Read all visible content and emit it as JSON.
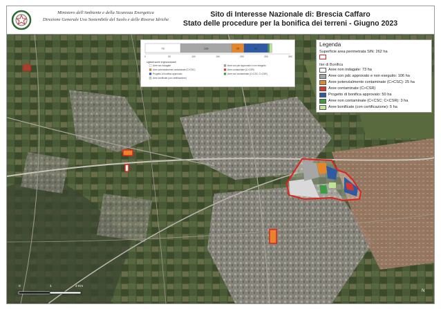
{
  "header": {
    "ministry_line1": "Ministero dell'Ambiente e della Sicurezza Energetica",
    "ministry_line2": "Direzione Generale Uso Sostenibile del Suolo e delle Risorse Idriche",
    "title_line1": "Sito di Interesse Nazionale di: Brescia Caffaro",
    "title_line2": "Stato delle procedure per la bonifica dei terreni - Giugno 2023"
  },
  "legend": {
    "title": "Legenda",
    "perimeter_label": "Superficie area perimetrata SIN: 262 ha",
    "section_label": "Iter di Bonifica",
    "items": [
      {
        "label": "Aree non indagate: 73 ha",
        "color": "#ffffff"
      },
      {
        "label": "Aree con pdc approvato e non eseguito: 106 ha",
        "color": "#a6a6a6"
      },
      {
        "label": "Aree potenzialmente contaminate (C>CSC): 25 ha",
        "color": "#e5862b"
      },
      {
        "label": "Aree contaminate (C>CSR)",
        "color": "#d9362b"
      },
      {
        "label": "Progetto di bonifica approvato: 50 ha",
        "color": "#2d5aa3"
      },
      {
        "label": "Aree non contaminate (C<CSC; C<CSR): 3 ha",
        "color": "#3f9b43"
      },
      {
        "label": "Aree bonificate (con certificazione): 5 ha",
        "color": "#bfe39a"
      }
    ],
    "perimeter_color": "#e2211c"
  },
  "chart_data": {
    "type": "bar",
    "orientation": "horizontal-stacked",
    "categories": [
      "Aree SIN"
    ],
    "series": [
      {
        "name": "Aree non indagate",
        "values": [
          73
        ],
        "color": "#ffffff"
      },
      {
        "name": "Aree con pdc approvato e non eseguito",
        "values": [
          106
        ],
        "color": "#a6a6a6"
      },
      {
        "name": "Aree potenzialmente contaminate (C>CSC)",
        "values": [
          25
        ],
        "color": "#e5862b"
      },
      {
        "name": "Progetto di bonifica approvato",
        "values": [
          50
        ],
        "color": "#2d5aa3"
      },
      {
        "name": "Aree non contaminate (C<CSC; C<CSR)",
        "values": [
          3
        ],
        "color": "#3f9b43"
      },
      {
        "name": "Aree bonificate (con certificazione)",
        "values": [
          5
        ],
        "color": "#bfe39a"
      }
    ],
    "bar_labels": [
      "73",
      "106",
      "25",
      "50"
    ],
    "xlim": [
      0,
      300
    ],
    "xticks": [
      "0",
      "50",
      "100",
      "150",
      "200",
      "250",
      "300"
    ],
    "legend_title": "Ugitadi suere ergeonosicacti",
    "legend_entries": [
      "Aree non indagate",
      "Aree con pdc approvato e non eseguito",
      "Aree potenzialmente contaminate (C>CSC)",
      "Aree contaminate (C>CSR)",
      "Progetto di bonifica approvato",
      "Aree non contaminate (C<CSC; C<CSR)",
      "Aree bonificate (con certificazione)"
    ]
  },
  "scale": {
    "labels": [
      "0",
      "1",
      "2 Km"
    ]
  },
  "north": "N"
}
